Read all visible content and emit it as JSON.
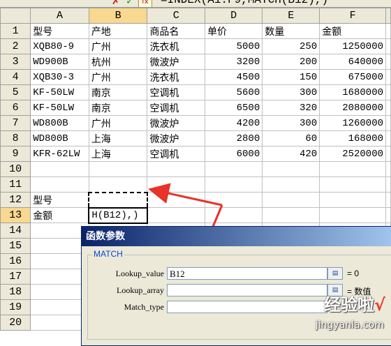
{
  "formula_bar": {
    "cancel_icon": "✗",
    "enter_icon": "✓",
    "fx_label": "fx",
    "formula": "=INDEX(A1:F9,MATCH(B12),)"
  },
  "columns": [
    "A",
    "B",
    "C",
    "D",
    "E",
    "F"
  ],
  "rows": [
    {
      "num": "1",
      "cells": [
        "型号",
        "产地",
        "商品名",
        "单价",
        "数量",
        "金额"
      ]
    },
    {
      "num": "2",
      "cells": [
        "XQB80-9",
        "广州",
        "洗衣机",
        "5000",
        "250",
        "1250000"
      ]
    },
    {
      "num": "3",
      "cells": [
        "WD900B",
        "杭州",
        "微波炉",
        "3200",
        "200",
        "640000"
      ]
    },
    {
      "num": "4",
      "cells": [
        "XQB30-3",
        "广州",
        "洗衣机",
        "4500",
        "150",
        "675000"
      ]
    },
    {
      "num": "5",
      "cells": [
        "KF-50LW",
        "南京",
        "空调机",
        "5600",
        "300",
        "1680000"
      ]
    },
    {
      "num": "6",
      "cells": [
        "KF-50LW",
        "南京",
        "空调机",
        "6500",
        "320",
        "2080000"
      ]
    },
    {
      "num": "7",
      "cells": [
        "WD800B",
        "广州",
        "微波炉",
        "4200",
        "300",
        "1260000"
      ]
    },
    {
      "num": "8",
      "cells": [
        "WD800B",
        "上海",
        "微波炉",
        "2800",
        "60",
        "168000"
      ]
    },
    {
      "num": "9",
      "cells": [
        "KFR-62LW",
        "上海",
        "空调机",
        "6000",
        "420",
        "2520000"
      ]
    },
    {
      "num": "10",
      "cells": [
        "",
        "",
        "",
        "",
        "",
        ""
      ]
    },
    {
      "num": "11",
      "cells": [
        "",
        "",
        "",
        "",
        "",
        ""
      ]
    },
    {
      "num": "12",
      "cells": [
        "型号",
        "",
        "",
        "",
        "",
        ""
      ]
    },
    {
      "num": "13",
      "cells": [
        "金额",
        "H(B12),)",
        "",
        "",
        "",
        ""
      ]
    },
    {
      "num": "14",
      "cells": [
        "",
        "",
        "",
        "",
        "",
        ""
      ]
    },
    {
      "num": "15",
      "cells": [
        "",
        "",
        "",
        "",
        "",
        ""
      ]
    },
    {
      "num": "16",
      "cells": [
        "",
        "",
        "",
        "",
        "",
        ""
      ]
    },
    {
      "num": "17",
      "cells": [
        "",
        "",
        "",
        "",
        "",
        ""
      ]
    },
    {
      "num": "18",
      "cells": [
        "",
        "",
        "",
        "",
        "",
        ""
      ]
    },
    {
      "num": "19",
      "cells": [
        "",
        "",
        "",
        "",
        "",
        ""
      ]
    },
    {
      "num": "20",
      "cells": [
        "",
        "",
        "",
        "",
        "",
        ""
      ]
    }
  ],
  "dialog": {
    "title": "函数参数",
    "function_name": "MATCH",
    "args": [
      {
        "label": "Lookup_value",
        "value": "B12",
        "result": "= 0"
      },
      {
        "label": "Lookup_array",
        "value": "",
        "result": "= 数值"
      },
      {
        "label": "Match_type",
        "value": "",
        "result": ""
      }
    ]
  },
  "watermark": {
    "text": "经验啦",
    "check": "√",
    "url": "jingyanla.com"
  },
  "colors": {
    "arrow": "#e8322a",
    "title_bar": "#0a246a",
    "selected_header": "#f9d88f"
  }
}
